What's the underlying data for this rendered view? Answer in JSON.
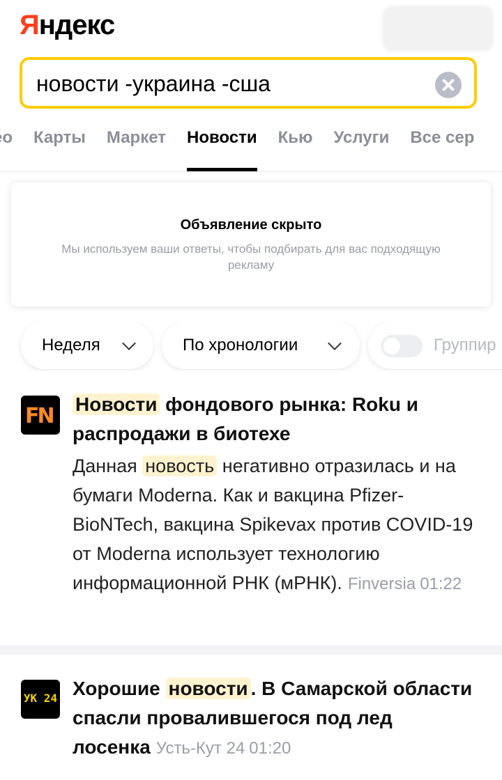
{
  "header": {
    "logo_first_letter": "Я",
    "logo_rest": "ндекс"
  },
  "search": {
    "query": "новости -украина -сша"
  },
  "tabs": [
    {
      "label": "ео",
      "active": false
    },
    {
      "label": "Карты",
      "active": false
    },
    {
      "label": "Маркет",
      "active": false
    },
    {
      "label": "Новости",
      "active": true
    },
    {
      "label": "Кью",
      "active": false
    },
    {
      "label": "Услуги",
      "active": false
    },
    {
      "label": "Все сер",
      "active": false
    }
  ],
  "ad": {
    "title": "Объявление скрыто",
    "description": "Мы используем ваши ответы, чтобы подбирать для вас подходящую рекламу"
  },
  "filters": {
    "period": "Неделя",
    "sort": "По хронологии",
    "group": "Группир"
  },
  "news": [
    {
      "source_logo_text": "FN",
      "title_highlight": "Новости",
      "title_rest": " фондового рынка: Roku и распродажи в биотехе",
      "snippet_before": "Данная ",
      "snippet_highlight": "новость",
      "snippet_after": " негативно отразилась и на бумаги Moderna. Как и вакцина Pfizer-BioNTech, вакцина Spikevax против COVID-19 от Moderna использует технологию информационной РНК (мРНК).",
      "source": "Finversia",
      "time": "01:22"
    },
    {
      "source_logo_text": "УК 24",
      "title_before": "Хорошие ",
      "title_highlight": "новости",
      "title_rest": ". В Самарской области спасли провалившегося под лед лосенка",
      "source": "Усть-Кут 24",
      "time": "01:20"
    }
  ],
  "colors": {
    "brand_red": "#fc3f1d",
    "search_border": "#ffcc00",
    "highlight_bg": "#fff3cf",
    "muted_text": "#9a9ea7"
  }
}
